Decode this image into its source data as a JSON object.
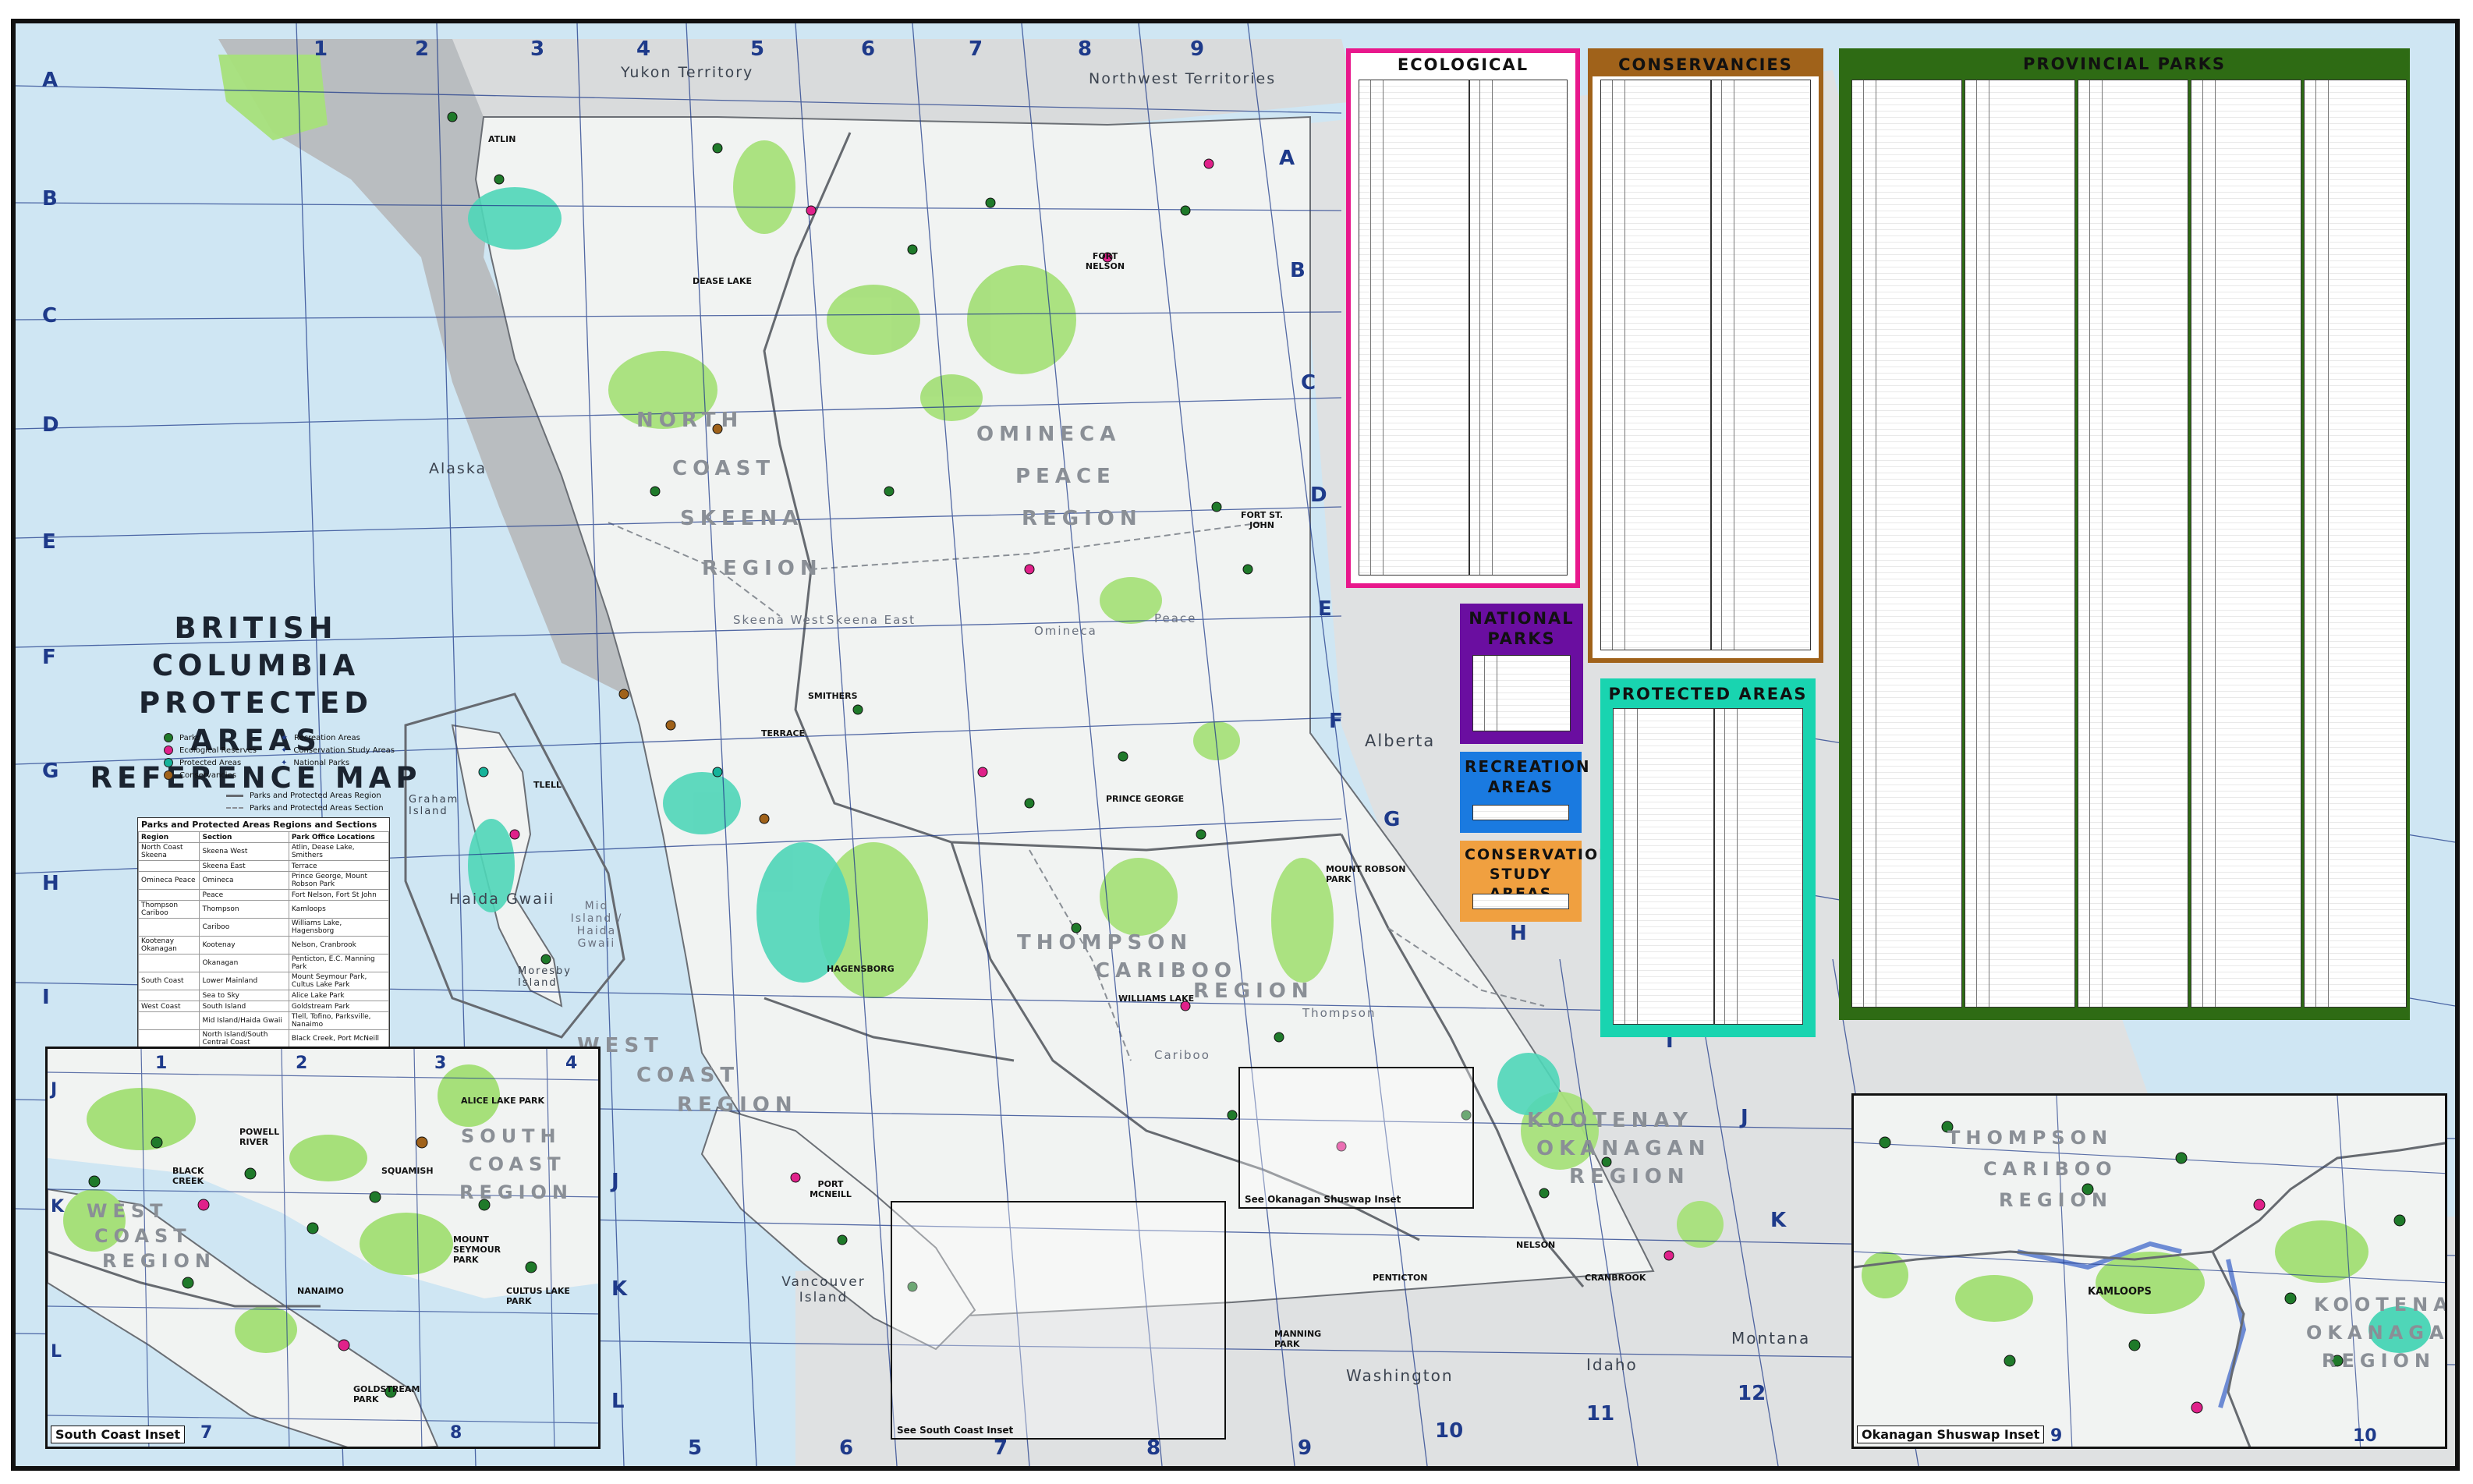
{
  "map": {
    "title_lines": [
      "BRITISH COLUMBIA",
      "PROTECTED AREAS",
      "REFERENCE MAP"
    ],
    "colors": {
      "ocean": "#cfe6f3",
      "land_bc": "#f1f3f2",
      "land_outside": "#c9ccce",
      "parks": "#a6e07a",
      "protected_areas": "#4fd6b8",
      "region_border": "#666a70",
      "grid": "#1e3a8a"
    },
    "grid_columns_top": [
      "1",
      "2",
      "3",
      "4",
      "5",
      "6",
      "7",
      "8",
      "9"
    ],
    "grid_columns_bottom": [
      "5",
      "6",
      "7",
      "8",
      "9",
      "10",
      "11",
      "12"
    ],
    "grid_rows_left": [
      "A",
      "B",
      "C",
      "D",
      "E",
      "F",
      "G",
      "H",
      "I"
    ],
    "grid_rows_right": [
      "A",
      "B",
      "C",
      "D",
      "E",
      "F",
      "G",
      "H",
      "I",
      "J",
      "K"
    ],
    "grid_rows_inset_left": [
      "J",
      "K",
      "L"
    ],
    "grid_rows_center": [
      "J",
      "K",
      "L"
    ],
    "inset_columns": [
      "1",
      "2",
      "3",
      "4"
    ],
    "inset_columns_bottom": [
      "7",
      "8"
    ],
    "inset2_columns_bottom": [
      "9",
      "10"
    ]
  },
  "regions": {
    "north": [
      "NORTH",
      "COAST",
      "SKEENA",
      "REGION"
    ],
    "omineca": [
      "OMINECA",
      "PEACE",
      "REGION"
    ],
    "thompson": [
      "THOMPSON",
      "CARIBOO",
      "REGION"
    ],
    "west_coast": [
      "WEST",
      "COAST",
      "REGION"
    ],
    "kootenay": [
      "KOOTENAY",
      "OKANAGAN",
      "REGION"
    ],
    "south_coast": [
      "SOUTH",
      "COAST",
      "REGION"
    ],
    "sections": [
      "Skeena West",
      "Skeena East",
      "Omineca",
      "Peace",
      "Mid Island / Haida Gwaii",
      "Thompson",
      "Cariboo"
    ]
  },
  "geography": {
    "yukon": "Yukon Territory",
    "nwt": "Northwest Territories",
    "alaska": "Alaska",
    "alberta": "Alberta",
    "washington": "Washington",
    "idaho": "Idaho",
    "montana": "Montana",
    "haida_gwaii": "Haida Gwaii",
    "graham_island": "Graham Island",
    "moresby_island": "Moresby Island",
    "vancouver_island": "Vancouver Island"
  },
  "cities": {
    "atlin": "ATLIN",
    "dease_lake": "DEASE LAKE",
    "fort_nelson": "FORT NELSON",
    "fort_st_john": "FORT ST. JOHN",
    "smithers": "SMITHERS",
    "terrace": "TERRACE",
    "prince_george": "PRINCE GEORGE",
    "mount_robson": "MOUNT ROBSON PARK",
    "williams_lake": "WILLIAMS LAKE",
    "hagensborg": "HAGENSBORG",
    "tlell": "TLELL",
    "kamloops": "KAMLOOPS",
    "nelson": "NELSON",
    "cranbrook": "CRANBROOK",
    "penticton": "PENTICTON",
    "manning": "MANNING PARK",
    "port_mcneill": "PORT MCNEILL",
    "black_creek": "BLACK CREEK",
    "powell_river": "POWELL RIVER",
    "squamish": "SQUAMISH",
    "nanaimo": "NANAIMO",
    "goldstream": "GOLDSTREAM PARK",
    "cultus_lake": "CULTUS LAKE PARK",
    "mount_seymour": "MOUNT SEYMOUR PARK",
    "alice_lake": "ALICE LAKE PARK"
  },
  "legend": {
    "items": [
      {
        "label": "Parks",
        "color": "#1f7a2a"
      },
      {
        "label": "Ecological Reserves",
        "color": "#e0218a"
      },
      {
        "label": "Protected Areas",
        "color": "#16b39a"
      },
      {
        "label": "Conservancies",
        "color": "#a0621a"
      }
    ],
    "items_right": [
      {
        "label": "Recreation Areas",
        "icon": "star-icon"
      },
      {
        "label": "Conservation Study Areas",
        "icon": "star-icon"
      },
      {
        "label": "National Parks",
        "icon": "star-icon"
      }
    ],
    "line_items": [
      "Parks and Protected Areas Region",
      "Parks and Protected Areas Section"
    ]
  },
  "region_table": {
    "title": "Parks and Protected Areas Regions and Sections",
    "headers": [
      "Region",
      "Section",
      "Park Office Locations"
    ],
    "rows": [
      [
        "North Coast Skeena",
        "Skeena West",
        "Atlin, Dease Lake, Smithers"
      ],
      [
        "",
        "Skeena East",
        "Terrace"
      ],
      [
        "Omineca Peace",
        "Omineca",
        "Prince George, Mount Robson Park"
      ],
      [
        "",
        "Peace",
        "Fort Nelson, Fort St John"
      ],
      [
        "Thompson Cariboo",
        "Thompson",
        "Kamloops"
      ],
      [
        "",
        "Cariboo",
        "Williams Lake, Hagensborg"
      ],
      [
        "Kootenay Okanagan",
        "Kootenay",
        "Nelson, Cranbrook"
      ],
      [
        "",
        "Okanagan",
        "Penticton, E.C. Manning Park"
      ],
      [
        "South Coast",
        "Lower Mainland",
        "Mount Seymour Park, Cultus Lake Park"
      ],
      [
        "",
        "Sea to Sky",
        "Alice Lake Park"
      ],
      [
        "West Coast",
        "South Island",
        "Goldstream Park"
      ],
      [
        "",
        "Mid Island/Haida Gwaii",
        "Tlell, Tofino, Parksville, Nanaimo"
      ],
      [
        "",
        "North Island/South Central Coast",
        "Black Creek, Port McNeill"
      ]
    ]
  },
  "panels": {
    "ecological_reserves": {
      "title": "ECOLOGICAL RESERVES",
      "color": "#e8188c"
    },
    "conservancies": {
      "title": "CONSERVANCIES",
      "color": "#a0621a"
    },
    "provincial_parks": {
      "title": "PROVINCIAL PARKS",
      "color": "#2e6b14"
    },
    "national_parks": {
      "title_1": "NATIONAL",
      "title_2": "PARKS",
      "color": "#6a0ea0"
    },
    "protected_areas": {
      "title": "PROTECTED AREAS",
      "color": "#19d4b0"
    },
    "recreation_areas": {
      "title_1": "RECREATION",
      "title_2": "AREAS",
      "color": "#1a7ae0"
    },
    "conservation_study_areas": {
      "title_1": "CONSERVATION",
      "title_2": "STUDY AREAS",
      "color": "#f0a040"
    }
  },
  "insets": {
    "south_coast": {
      "label": "South Coast Inset"
    },
    "okanagan": {
      "label": "Okanagan Shuswap Inset"
    },
    "see_south_coast": "See South Coast Inset",
    "see_okanagan": "See Okanagan Shuswap Inset"
  }
}
